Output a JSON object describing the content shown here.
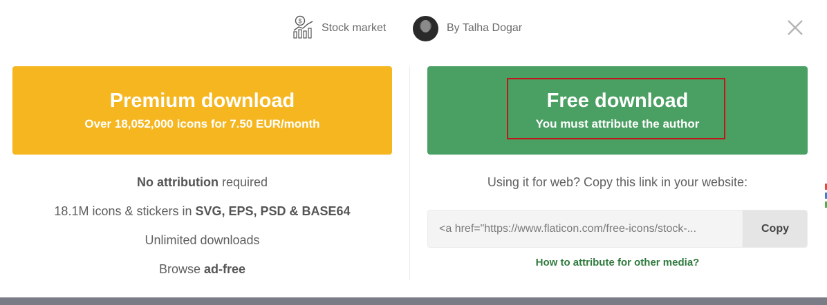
{
  "header": {
    "topic_label": "Stock market",
    "topic_icon": "stock-market-icon",
    "author_label": "By Talha Dogar",
    "close_icon": "close-icon"
  },
  "premium": {
    "title": "Premium download",
    "subtitle": "Over 18,052,000 icons for 7.50 EUR/month",
    "color": "#f5b61f",
    "features": [
      {
        "bold": "No attribution",
        "rest": " required"
      },
      {
        "prefix": "18.1M icons & stickers in ",
        "bold": "SVG, EPS, PSD & BASE64"
      },
      {
        "text": "Unlimited downloads"
      },
      {
        "prefix": "Browse ",
        "bold": "ad-free"
      }
    ]
  },
  "free": {
    "title": "Free download",
    "subtitle": "You must attribute the author",
    "color": "#4a9f62",
    "web_hint": "Using it for web? Copy this link in your website:",
    "link_value": "<a href=\"https://www.flaticon.com/free-icons/stock-...",
    "copy_label": "Copy",
    "attribution_link": "How to attribute for other media?",
    "highlight_color": "#c1171c"
  }
}
